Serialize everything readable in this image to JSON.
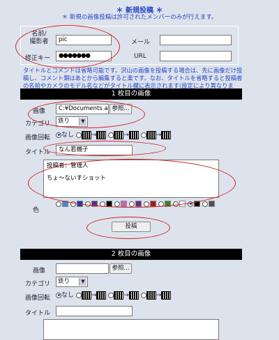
{
  "header": {
    "title": "＊ 新規投稿 ＊",
    "notice": "＊ 新規の画像投稿は許可されたメンバーのみが行えます。"
  },
  "user": {
    "name_label": "名前/撮影者",
    "name_value": "pic",
    "key_label": "修正キー",
    "key_value": "●●●●●●●",
    "mail_label": "メール",
    "url_label": "URL"
  },
  "info_text": "タイトルとコメントは省略可能です。沢山の画像を投稿する場合は、先に画像だけ投稿し、コメント類はあとから編集すると楽です。なお、タイトルを省略すると投稿者の名前やカメラのモデル名などがタイトル欄に表示されます(設定により異なります)。",
  "image1": {
    "header": "1 枚目の画像",
    "image_label": "画像",
    "file_value": "C:¥Documents and",
    "browse_label": "参照...",
    "category_label": "カテゴリ",
    "category_value": "鉄り",
    "rotate_label": "画像回転",
    "rotate_none": "なし",
    "title_label": "タイトル",
    "title_value": "なん若槻子",
    "comment_line1": "投稿者：管理人",
    "comment_line2": "ちょ〜ないすショット",
    "color_label": "色"
  },
  "submit_label": "投稿",
  "image2": {
    "header": "2 枚目の画像",
    "image_label": "画像",
    "browse_label": "参照...",
    "category_label": "カテゴリ",
    "category_value": "鉄り",
    "rotate_label": "画像回転",
    "rotate_none": "なし",
    "title_label": "タイトル"
  },
  "colors": {
    "swatches": [
      "#3a8ad8",
      "#1a3ab0",
      "#5a2a8a",
      "#000000",
      "#d060c0",
      "#5a3090",
      "#b01818",
      "#2a8a2a",
      "#ffffff",
      "#000000",
      "#505050"
    ],
    "checked_index": 9,
    "annotation_red": "#d52020",
    "link_blue": "#2a46c8"
  }
}
